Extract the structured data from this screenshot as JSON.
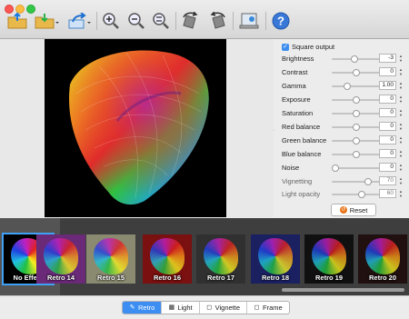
{
  "toolbar": {
    "buttons": [
      {
        "name": "open-folder-icon"
      },
      {
        "name": "import-folder-icon"
      },
      {
        "name": "share-icon"
      },
      {
        "name": "zoom-in-icon"
      },
      {
        "name": "zoom-out-icon"
      },
      {
        "name": "zoom-fit-icon"
      },
      {
        "name": "rotate-left-icon"
      },
      {
        "name": "rotate-right-icon"
      },
      {
        "name": "export-icon"
      },
      {
        "name": "help-icon",
        "label": "?"
      }
    ]
  },
  "panel": {
    "square_output_label": "Square output",
    "square_output_checked": true,
    "sliders": [
      {
        "label": "Brightness",
        "value": "-3",
        "level": 0.47
      },
      {
        "label": "Contrast",
        "value": "0",
        "level": 0.5
      },
      {
        "label": "Gamma",
        "value": "1.00",
        "level": 0.33
      },
      {
        "label": "Exposure",
        "value": "0",
        "level": 0.5
      },
      {
        "label": "Saturation",
        "value": "0",
        "level": 0.5
      },
      {
        "label": "Red balance",
        "value": "0",
        "level": 0.5
      },
      {
        "label": "Green balance",
        "value": "0",
        "level": 0.5
      },
      {
        "label": "Blue balance",
        "value": "0",
        "level": 0.5
      },
      {
        "label": "Noise",
        "value": "0",
        "level": 0.08
      },
      {
        "label": "Vignetting",
        "value": "70",
        "level": 0.75,
        "dim": true
      },
      {
        "label": "Light opacity",
        "value": "60",
        "level": 0.62,
        "dim": true
      }
    ],
    "reset_label": "Reset"
  },
  "filmstrip": {
    "items": [
      {
        "label": "No Effect",
        "selected": true,
        "tint": "#000000"
      },
      {
        "label": "Retro 14",
        "tint": "#6a2a78"
      },
      {
        "label": "Retro 15",
        "tint": "#8a8a70"
      },
      {
        "label": "Retro 16",
        "tint": "#7a1010"
      },
      {
        "label": "Retro 17",
        "tint": "#303030"
      },
      {
        "label": "Retro 18",
        "tint": "#1a2060"
      },
      {
        "label": "Retro 19",
        "tint": "#101010"
      },
      {
        "label": "Retro 20",
        "tint": "#201010"
      }
    ]
  },
  "tabs": [
    {
      "label": "Retro",
      "icon": "retro-wand-icon",
      "active": true
    },
    {
      "label": "Light",
      "icon": "light-grid-icon"
    },
    {
      "label": "Vignette",
      "icon": "vignette-square-icon"
    },
    {
      "label": "Frame",
      "icon": "frame-square-icon"
    }
  ]
}
